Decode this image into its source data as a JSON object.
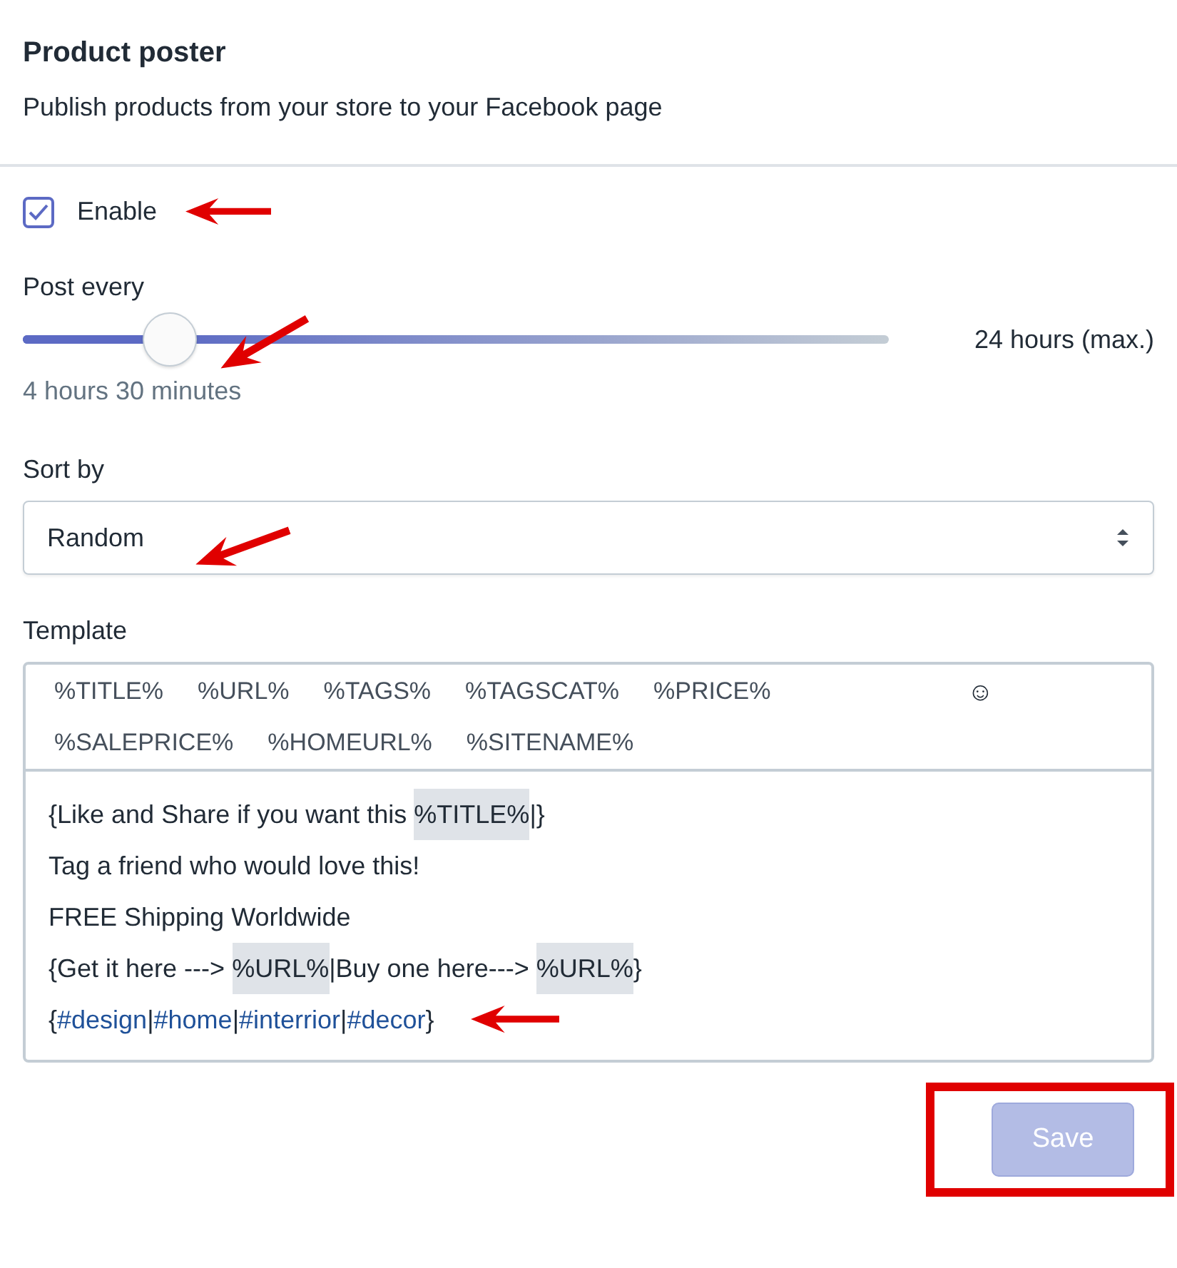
{
  "header": {
    "title": "Product poster",
    "subtitle": "Publish products from your store to your Facebook page"
  },
  "enable": {
    "label": "Enable",
    "checked": true
  },
  "post_every": {
    "label": "Post every",
    "level": 0.17,
    "max_label": "24 hours (max.)",
    "reading": "4 hours 30 minutes"
  },
  "sort_by": {
    "label": "Sort by",
    "value": "Random"
  },
  "template": {
    "label": "Template",
    "tokens": [
      "%TITLE%",
      "%URL%",
      "%TAGS%",
      "%TAGSCAT%",
      "%PRICE%",
      "%SALEPRICE%",
      "%HOMEURL%",
      "%SITENAME%"
    ],
    "emoji": "☺",
    "lines": [
      [
        {
          "kind": "text",
          "text": "{Like and Share if you want this "
        },
        {
          "kind": "token",
          "text": "%TITLE%"
        },
        {
          "kind": "text",
          "text": "|}"
        }
      ],
      [
        {
          "kind": "text",
          "text": "Tag a friend who would love this!"
        }
      ],
      [
        {
          "kind": "text",
          "text": "FREE Shipping Worldwide"
        }
      ],
      [
        {
          "kind": "text",
          "text": "{Get it here ---> "
        },
        {
          "kind": "token",
          "text": "%URL%"
        },
        {
          "kind": "text",
          "text": "|Buy one here---> "
        },
        {
          "kind": "token",
          "text": "%URL%"
        },
        {
          "kind": "text",
          "text": "}"
        }
      ],
      [
        {
          "kind": "text",
          "text": "{"
        },
        {
          "kind": "tag",
          "text": "#design"
        },
        {
          "kind": "text",
          "text": "|"
        },
        {
          "kind": "tag",
          "text": "#home"
        },
        {
          "kind": "text",
          "text": "|"
        },
        {
          "kind": "tag",
          "text": "#interrior"
        },
        {
          "kind": "text",
          "text": "|"
        },
        {
          "kind": "tag",
          "text": "#decor"
        },
        {
          "kind": "text",
          "text": "}"
        }
      ]
    ]
  },
  "save": {
    "label": "Save",
    "disabled": true
  }
}
